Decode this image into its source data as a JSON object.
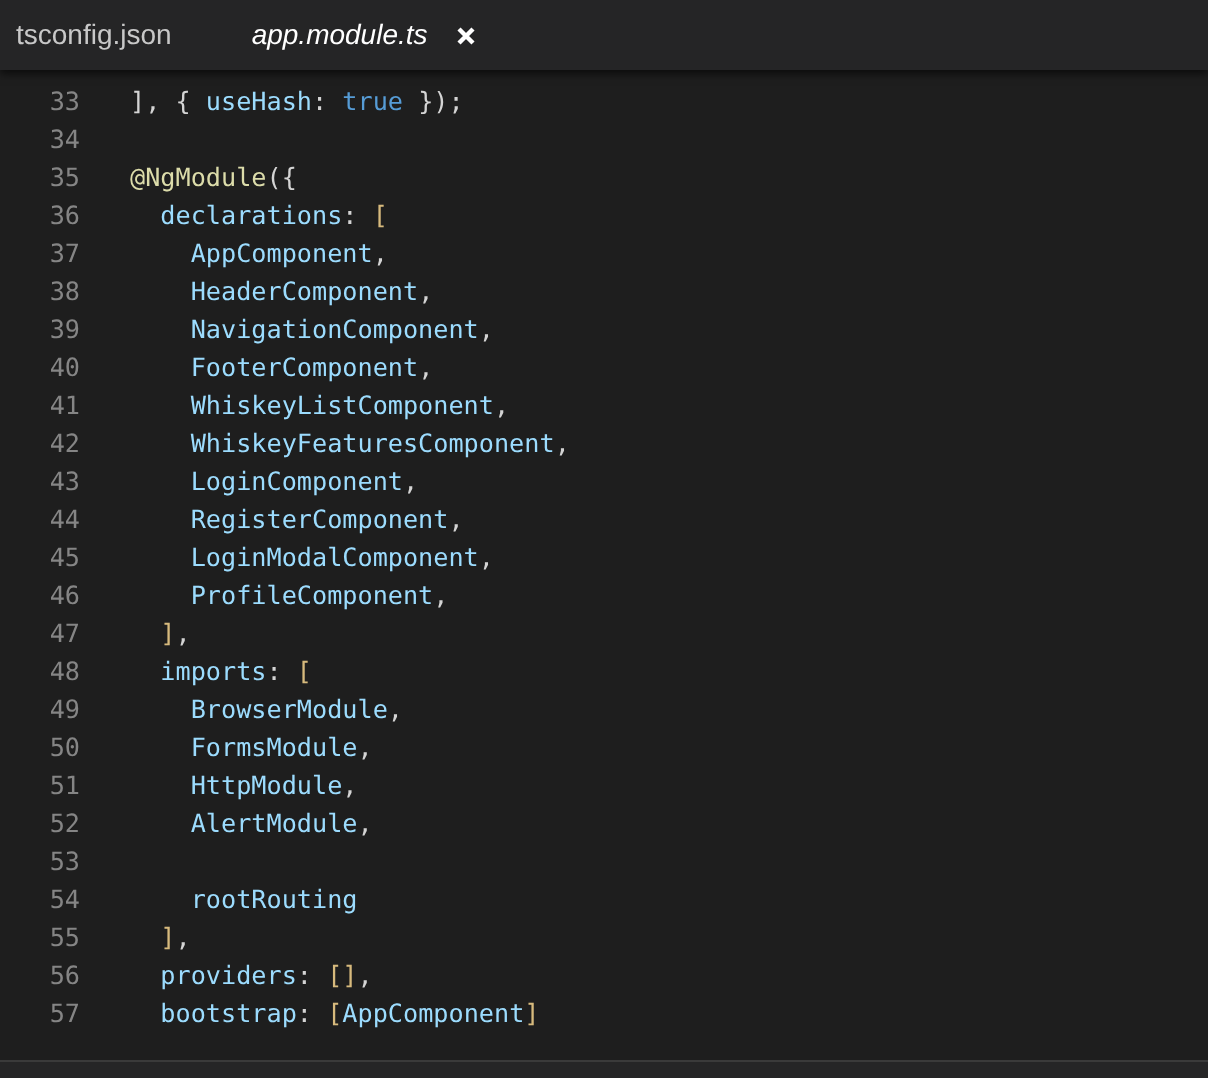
{
  "tabs": [
    {
      "label": "tsconfig.json",
      "selected": false
    },
    {
      "label": "app.module.ts",
      "selected": true
    }
  ],
  "editor": {
    "lines": [
      {
        "number": "33",
        "tokens": [
          {
            "text": "], { ",
            "kind": "punct"
          },
          {
            "text": "useHash",
            "kind": "ident"
          },
          {
            "text": ": ",
            "kind": "punct"
          },
          {
            "text": "true",
            "kind": "keyword"
          },
          {
            "text": " });",
            "kind": "punct"
          }
        ]
      },
      {
        "number": "34"
      },
      {
        "number": "35",
        "tokens": [
          {
            "text": "@NgModule",
            "kind": "decorator"
          },
          {
            "text": "({",
            "kind": "punct"
          }
        ]
      },
      {
        "number": "36",
        "tokens": [
          {
            "text": "  declarations",
            "kind": "ident"
          },
          {
            "text": ": ",
            "kind": "punct"
          },
          {
            "text": "[",
            "kind": "bracket"
          }
        ]
      },
      {
        "number": "37",
        "tokens": [
          {
            "text": "    AppComponent",
            "kind": "ident"
          },
          {
            "text": ",",
            "kind": "punct"
          }
        ]
      },
      {
        "number": "38",
        "tokens": [
          {
            "text": "    HeaderComponent",
            "kind": "ident"
          },
          {
            "text": ",",
            "kind": "punct"
          }
        ]
      },
      {
        "number": "39",
        "tokens": [
          {
            "text": "    NavigationComponent",
            "kind": "ident"
          },
          {
            "text": ",",
            "kind": "punct"
          }
        ]
      },
      {
        "number": "40",
        "tokens": [
          {
            "text": "    FooterComponent",
            "kind": "ident"
          },
          {
            "text": ",",
            "kind": "punct"
          }
        ]
      },
      {
        "number": "41",
        "tokens": [
          {
            "text": "    WhiskeyListComponent",
            "kind": "ident"
          },
          {
            "text": ",",
            "kind": "punct"
          }
        ]
      },
      {
        "number": "42",
        "tokens": [
          {
            "text": "    WhiskeyFeaturesComponent",
            "kind": "ident"
          },
          {
            "text": ",",
            "kind": "punct"
          }
        ]
      },
      {
        "number": "43",
        "tokens": [
          {
            "text": "    LoginComponent",
            "kind": "ident"
          },
          {
            "text": ",",
            "kind": "punct"
          }
        ]
      },
      {
        "number": "44",
        "tokens": [
          {
            "text": "    RegisterComponent",
            "kind": "ident"
          },
          {
            "text": ",",
            "kind": "punct"
          }
        ]
      },
      {
        "number": "45",
        "tokens": [
          {
            "text": "    LoginModalComponent",
            "kind": "ident"
          },
          {
            "text": ",",
            "kind": "punct"
          }
        ]
      },
      {
        "number": "46",
        "tokens": [
          {
            "text": "    ProfileComponent",
            "kind": "ident"
          },
          {
            "text": ",",
            "kind": "punct"
          }
        ]
      },
      {
        "number": "47",
        "tokens": [
          {
            "text": "  ]",
            "kind": "bracket"
          },
          {
            "text": ",",
            "kind": "punct"
          }
        ]
      },
      {
        "number": "48",
        "tokens": [
          {
            "text": "  imports",
            "kind": "ident"
          },
          {
            "text": ": ",
            "kind": "punct"
          },
          {
            "text": "[",
            "kind": "bracket"
          }
        ]
      },
      {
        "number": "49",
        "tokens": [
          {
            "text": "    BrowserModule",
            "kind": "ident"
          },
          {
            "text": ",",
            "kind": "punct"
          }
        ]
      },
      {
        "number": "50",
        "tokens": [
          {
            "text": "    FormsModule",
            "kind": "ident"
          },
          {
            "text": ",",
            "kind": "punct"
          }
        ]
      },
      {
        "number": "51",
        "tokens": [
          {
            "text": "    HttpModule",
            "kind": "ident"
          },
          {
            "text": ",",
            "kind": "punct"
          }
        ]
      },
      {
        "number": "52",
        "tokens": [
          {
            "text": "    AlertModule",
            "kind": "ident"
          },
          {
            "text": ",",
            "kind": "punct"
          }
        ]
      },
      {
        "number": "53"
      },
      {
        "number": "54",
        "tokens": [
          {
            "text": "    rootRouting",
            "kind": "ident"
          }
        ]
      },
      {
        "number": "55",
        "tokens": [
          {
            "text": "  ]",
            "kind": "bracket"
          },
          {
            "text": ",",
            "kind": "punct"
          }
        ]
      },
      {
        "number": "56",
        "tokens": [
          {
            "text": "  providers",
            "kind": "ident"
          },
          {
            "text": ": ",
            "kind": "punct"
          },
          {
            "text": "[]",
            "kind": "bracket"
          },
          {
            "text": ",",
            "kind": "punct"
          }
        ]
      },
      {
        "number": "57",
        "tokens": [
          {
            "text": "  bootstrap",
            "kind": "ident"
          },
          {
            "text": ": ",
            "kind": "punct"
          },
          {
            "text": "[",
            "kind": "bracket"
          },
          {
            "text": "AppComponent",
            "kind": "ident"
          },
          {
            "text": "]",
            "kind": "bracket"
          }
        ]
      }
    ]
  }
}
